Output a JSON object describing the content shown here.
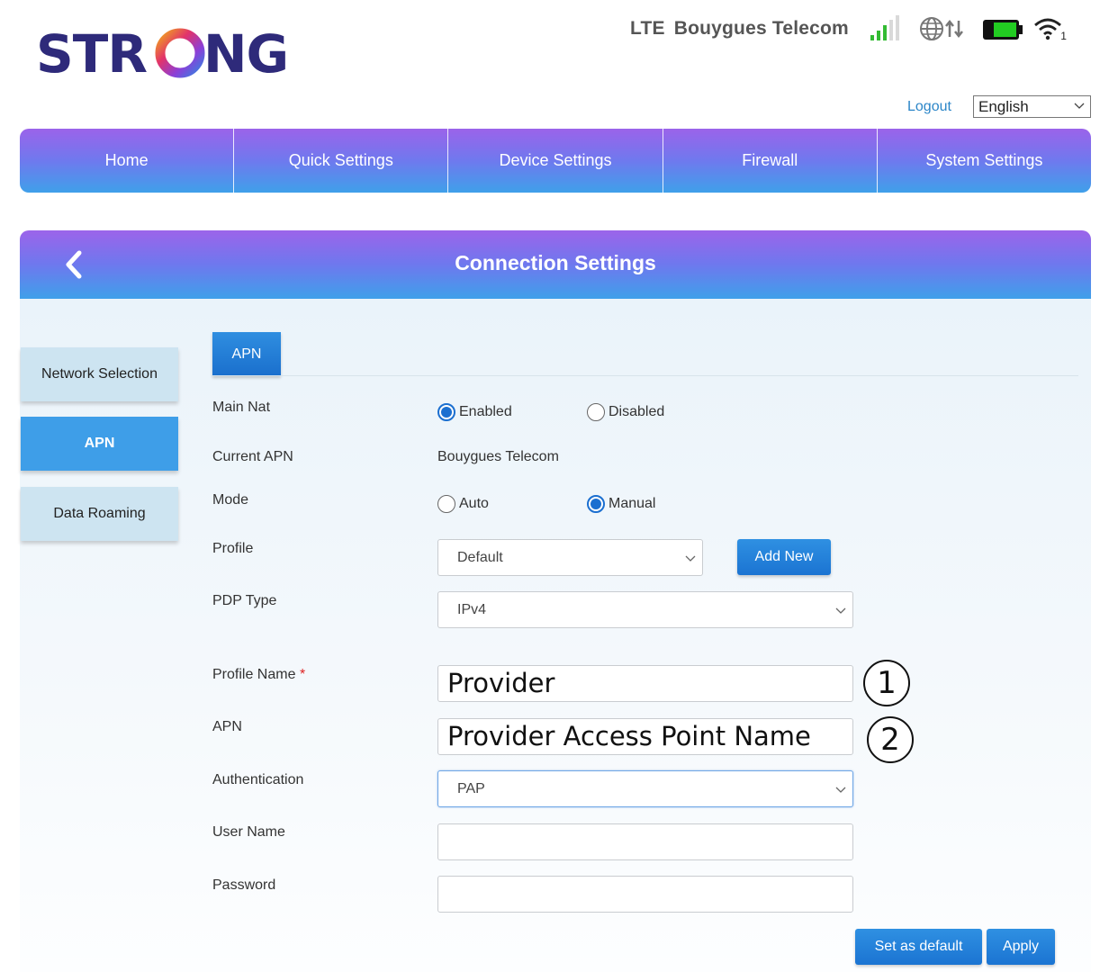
{
  "header": {
    "brand": "STRONG",
    "network_type": "LTE",
    "operator": "Bouygues Telecom",
    "wifi_clients": "1",
    "icons": [
      "signal-bars-icon",
      "globe-data-icon",
      "battery-icon",
      "wifi-icon"
    ],
    "colors": {
      "battery": "#22cc22",
      "signal": "#33bb33"
    }
  },
  "top": {
    "logout": "Logout",
    "language": "English"
  },
  "nav": [
    "Home",
    "Quick Settings",
    "Device Settings",
    "Firewall",
    "System Settings"
  ],
  "panel": {
    "title": "Connection Settings"
  },
  "side_menu": [
    {
      "label": "Network Selection",
      "active": false
    },
    {
      "label": "APN",
      "active": true
    },
    {
      "label": "Data Roaming",
      "active": false
    }
  ],
  "tab": "APN",
  "form": {
    "main_nat": {
      "label": "Main Nat",
      "enabled": "Enabled",
      "disabled": "Disabled",
      "selected": "Enabled"
    },
    "current_apn": {
      "label": "Current APN",
      "value": "Bouygues Telecom"
    },
    "mode": {
      "label": "Mode",
      "auto": "Auto",
      "manual": "Manual",
      "selected": "Manual"
    },
    "profile": {
      "label": "Profile",
      "value": "Default",
      "add_new": "Add New"
    },
    "pdp_type": {
      "label": "PDP Type",
      "value": "IPv4"
    },
    "profile_name": {
      "label": "Profile Name",
      "required": "*",
      "value": "Provider"
    },
    "apn": {
      "label": "APN",
      "value": "Provider Access Point Name"
    },
    "authentication": {
      "label": "Authentication",
      "value": "PAP"
    },
    "user_name": {
      "label": "User Name",
      "value": ""
    },
    "password": {
      "label": "Password",
      "value": ""
    }
  },
  "buttons": {
    "set_default": "Set as default",
    "apply": "Apply"
  },
  "callouts": [
    "1",
    "2"
  ],
  "colors": {
    "accent": "#1b74d2",
    "nav_gradient_top": "#9b63ea",
    "nav_gradient_bottom": "#3fa0ea"
  }
}
